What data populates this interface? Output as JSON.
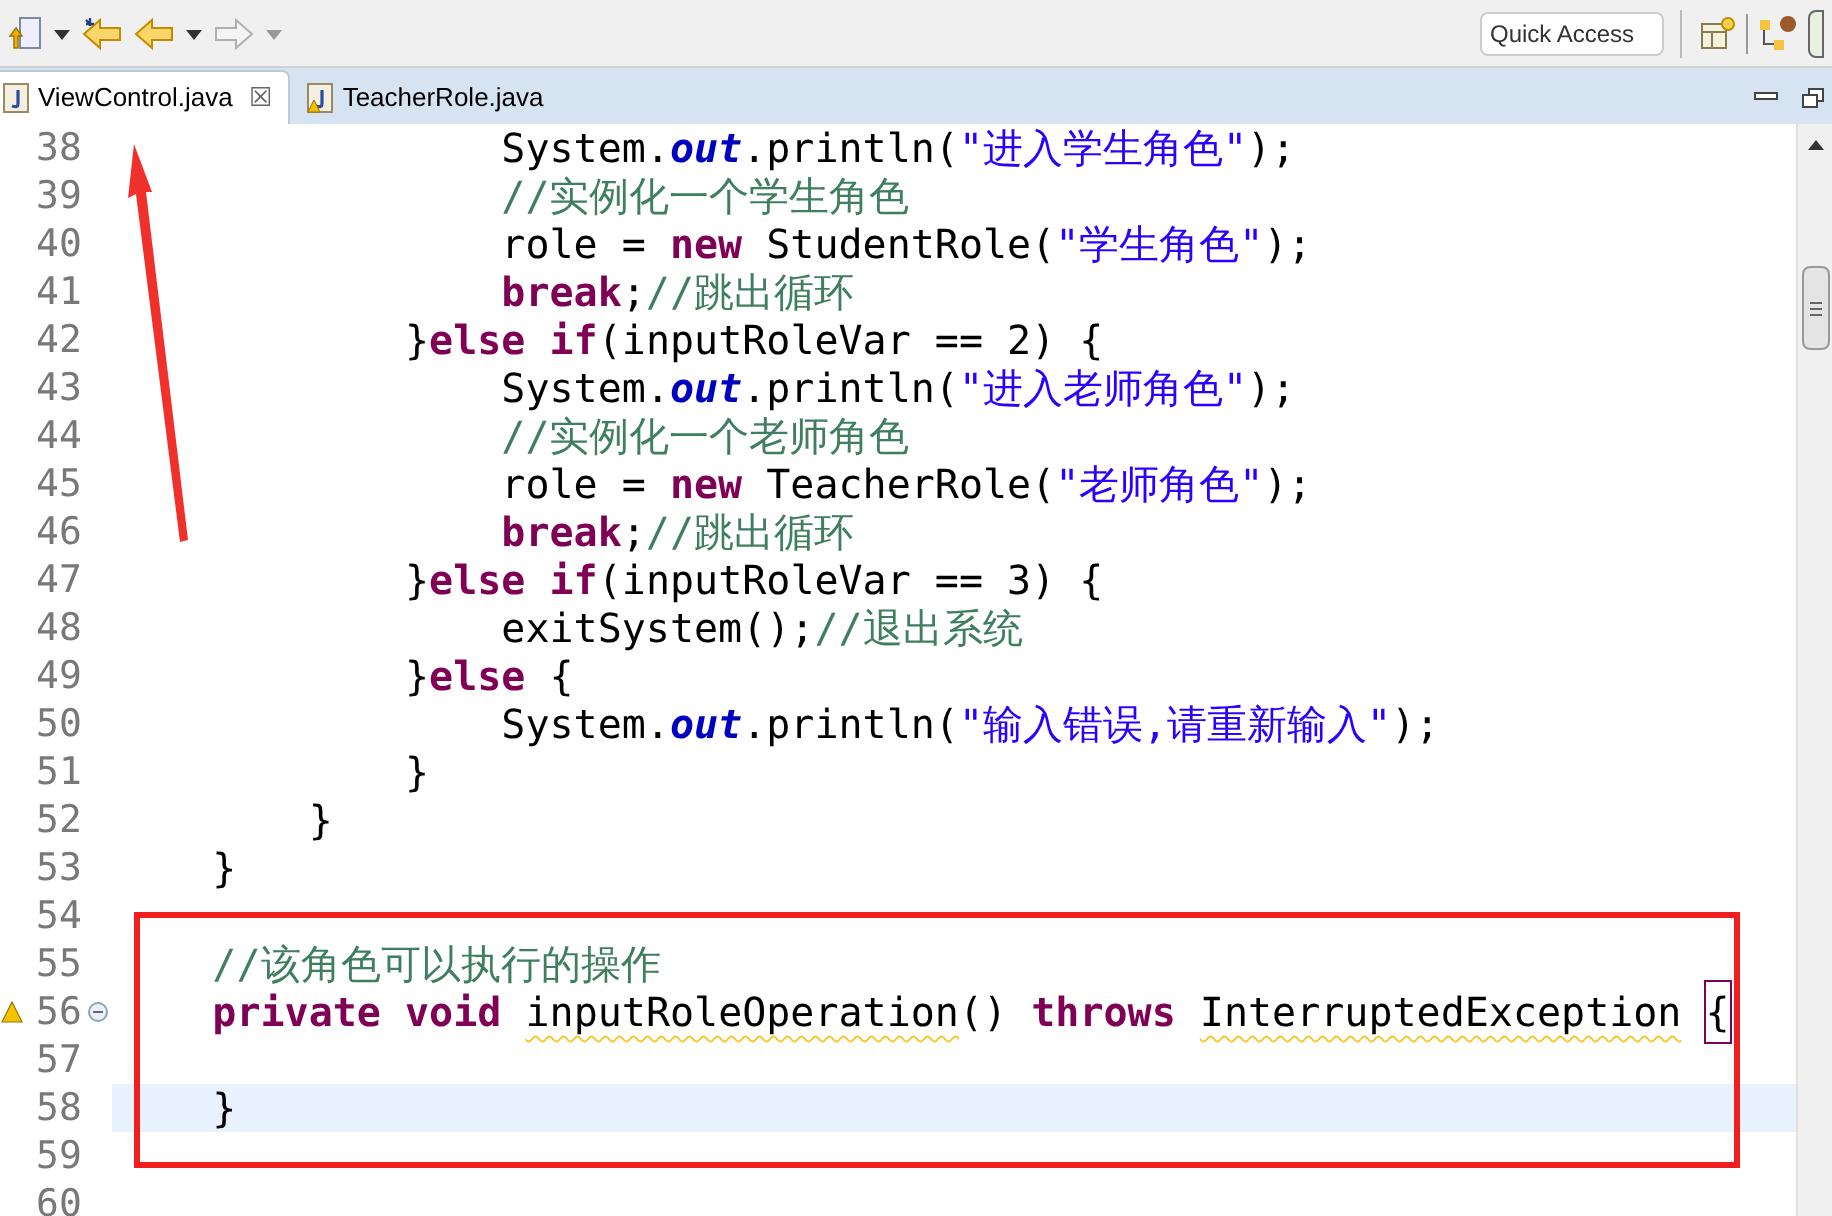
{
  "toolbar": {
    "quick_access": {
      "placeholder": "Quick Access"
    }
  },
  "tabs": [
    {
      "label": "ViewControl.java",
      "selected": true,
      "close": "☒"
    },
    {
      "label": "TeacherRole.java",
      "selected": false
    }
  ],
  "editor": {
    "lines": [
      {
        "number": "38",
        "tokens": [
          {
            "kind": "plain",
            "text": "                System."
          },
          {
            "kind": "field",
            "text": "out"
          },
          {
            "kind": "plain",
            "text": ".println("
          },
          {
            "kind": "string",
            "text": "\"进入学生角色\""
          },
          {
            "kind": "plain",
            "text": ");"
          }
        ]
      },
      {
        "number": "39",
        "tokens": [
          {
            "kind": "comment",
            "text": "                //实例化一个学生角色"
          }
        ]
      },
      {
        "number": "40",
        "tokens": [
          {
            "kind": "plain",
            "text": "                role = "
          },
          {
            "kind": "keyword",
            "text": "new"
          },
          {
            "kind": "plain",
            "text": " StudentRole("
          },
          {
            "kind": "string",
            "text": "\"学生角色\""
          },
          {
            "kind": "plain",
            "text": ");"
          }
        ]
      },
      {
        "number": "41",
        "tokens": [
          {
            "kind": "keyword",
            "text": "                break"
          },
          {
            "kind": "plain",
            "text": ";"
          },
          {
            "kind": "comment",
            "text": "//跳出循环"
          }
        ]
      },
      {
        "number": "42",
        "tokens": [
          {
            "kind": "plain",
            "text": "            }"
          },
          {
            "kind": "keyword",
            "text": "else"
          },
          {
            "kind": "keyword",
            "text": " if"
          },
          {
            "kind": "plain",
            "text": "(inputRoleVar == 2) {"
          }
        ]
      },
      {
        "number": "43",
        "tokens": [
          {
            "kind": "plain",
            "text": "                System."
          },
          {
            "kind": "field",
            "text": "out"
          },
          {
            "kind": "plain",
            "text": ".println("
          },
          {
            "kind": "string",
            "text": "\"进入老师角色\""
          },
          {
            "kind": "plain",
            "text": ");"
          }
        ]
      },
      {
        "number": "44",
        "tokens": [
          {
            "kind": "comment",
            "text": "                //实例化一个老师角色"
          }
        ]
      },
      {
        "number": "45",
        "tokens": [
          {
            "kind": "plain",
            "text": "                role = "
          },
          {
            "kind": "keyword",
            "text": "new"
          },
          {
            "kind": "plain",
            "text": " TeacherRole("
          },
          {
            "kind": "string",
            "text": "\"老师角色\""
          },
          {
            "kind": "plain",
            "text": ");"
          }
        ]
      },
      {
        "number": "46",
        "tokens": [
          {
            "kind": "keyword",
            "text": "                break"
          },
          {
            "kind": "plain",
            "text": ";"
          },
          {
            "kind": "comment",
            "text": "//跳出循环"
          }
        ]
      },
      {
        "number": "47",
        "tokens": [
          {
            "kind": "plain",
            "text": "            }"
          },
          {
            "kind": "keyword",
            "text": "else"
          },
          {
            "kind": "keyword",
            "text": " if"
          },
          {
            "kind": "plain",
            "text": "(inputRoleVar == 3) {"
          }
        ]
      },
      {
        "number": "48",
        "tokens": [
          {
            "kind": "plain",
            "text": "                exitSystem();"
          },
          {
            "kind": "comment",
            "text": "//退出系统"
          }
        ]
      },
      {
        "number": "49",
        "tokens": [
          {
            "kind": "plain",
            "text": "            }"
          },
          {
            "kind": "keyword",
            "text": "else"
          },
          {
            "kind": "plain",
            "text": " {"
          }
        ]
      },
      {
        "number": "50",
        "tokens": [
          {
            "kind": "plain",
            "text": "                System."
          },
          {
            "kind": "field",
            "text": "out"
          },
          {
            "kind": "plain",
            "text": ".println("
          },
          {
            "kind": "string",
            "text": "\"输入错误,请重新输入\""
          },
          {
            "kind": "plain",
            "text": ");"
          }
        ]
      },
      {
        "number": "51",
        "tokens": [
          {
            "kind": "plain",
            "text": "            }"
          }
        ]
      },
      {
        "number": "52",
        "tokens": [
          {
            "kind": "plain",
            "text": "        }"
          }
        ]
      },
      {
        "number": "53",
        "tokens": [
          {
            "kind": "plain",
            "text": "    }"
          }
        ]
      },
      {
        "number": "54"
      },
      {
        "number": "55",
        "tokens": [
          {
            "kind": "comment",
            "text": "    //该角色可以执行的操作"
          }
        ]
      },
      {
        "number": "56",
        "warning": true,
        "fold": true,
        "tokens": [
          {
            "kind": "keyword",
            "text": "    private"
          },
          {
            "kind": "keyword",
            "text": " void"
          },
          {
            "kind": "plain",
            "text": " inputRoleOperation",
            "squiggly": true
          },
          {
            "kind": "plain",
            "text": "() "
          },
          {
            "kind": "keyword",
            "text": "throws"
          },
          {
            "kind": "plain",
            "text": " InterruptedException",
            "squiggly": true
          },
          {
            "kind": "plain",
            "text": " {",
            "matched": true
          }
        ]
      },
      {
        "number": "57"
      },
      {
        "number": "58",
        "current": true,
        "tokens": [
          {
            "kind": "plain",
            "text": "    }"
          }
        ]
      },
      {
        "number": "59"
      },
      {
        "number": "60"
      }
    ]
  }
}
